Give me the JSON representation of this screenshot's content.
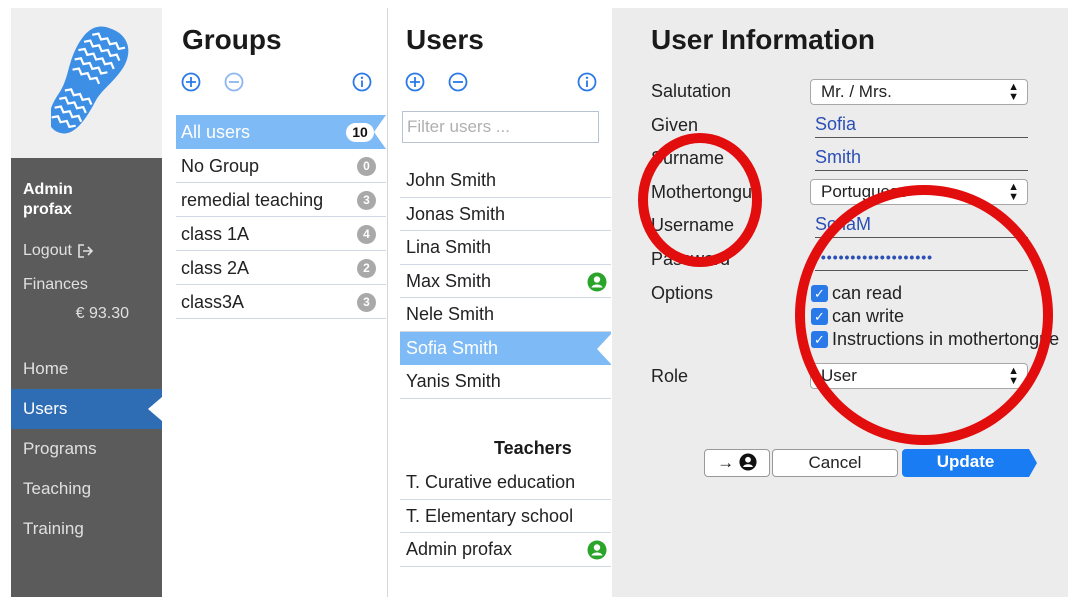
{
  "sidebar": {
    "user_name_line1": "Admin",
    "user_name_line2": "profax",
    "logout_label": "Logout",
    "finances_label": "Finances",
    "finances_value": "€ 93.30",
    "nav": [
      {
        "label": "Home",
        "active": false
      },
      {
        "label": "Users",
        "active": true
      },
      {
        "label": "Programs",
        "active": false
      },
      {
        "label": "Teaching",
        "active": false
      },
      {
        "label": "Training",
        "active": false
      }
    ]
  },
  "groups": {
    "title": "Groups",
    "items": [
      {
        "label": "All users",
        "count": "10",
        "active": true
      },
      {
        "label": "No Group",
        "count": "0"
      },
      {
        "label": "remedial teaching",
        "count": "3"
      },
      {
        "label": "class 1A",
        "count": "4"
      },
      {
        "label": "class 2A",
        "count": "2"
      },
      {
        "label": "class3A",
        "count": "3"
      }
    ]
  },
  "users": {
    "title": "Users",
    "filter_placeholder": "Filter users ...",
    "items": [
      {
        "label": "John Smith"
      },
      {
        "label": "Jonas  Smith"
      },
      {
        "label": "Lina  Smith"
      },
      {
        "label": "Max  Smith",
        "online": true
      },
      {
        "label": "Nele  Smith"
      },
      {
        "label": "Sofia  Smith",
        "active": true
      },
      {
        "label": "Yanis  Smith"
      }
    ],
    "teachers_heading": "Teachers",
    "teachers": [
      {
        "label": "T. Curative education"
      },
      {
        "label": "T. Elementary school"
      },
      {
        "label": "Admin profax",
        "online": true
      }
    ]
  },
  "info": {
    "title": "User Information",
    "salutation_label": "Salutation",
    "salutation_value": "Mr. / Mrs.",
    "given_label": "Given",
    "given_value": "Sofia",
    "surname_label": "Surname",
    "surname_value": "Smith",
    "mothertongue_label": "Mothertongue",
    "mothertongue_value": "Portuguese",
    "username_label": "Username",
    "username_value": "SofiaM",
    "password_label": "Password",
    "password_value": "••••••••••••••••••••",
    "options_label": "Options",
    "options": [
      {
        "label": "can read",
        "checked": true
      },
      {
        "label": "can write",
        "checked": true
      },
      {
        "label": "Instructions in mothertongue",
        "checked": true
      }
    ],
    "role_label": "Role",
    "role_value": "User",
    "login_as_label": "→",
    "cancel_label": "Cancel",
    "update_label": "Update"
  },
  "colors": {
    "sidebar_bg": "#5b5b5b",
    "active_nav": "#2e6db4",
    "selection": "#7ebaf5",
    "accent_blue": "#1a7cf2",
    "online_green": "#2aa52a",
    "annotation_red": "#e20d0d"
  },
  "icons": [
    "shoe-sole-logo",
    "add-circle-icon",
    "remove-circle-icon",
    "info-icon",
    "logout-icon",
    "person-icon",
    "check-icon"
  ]
}
